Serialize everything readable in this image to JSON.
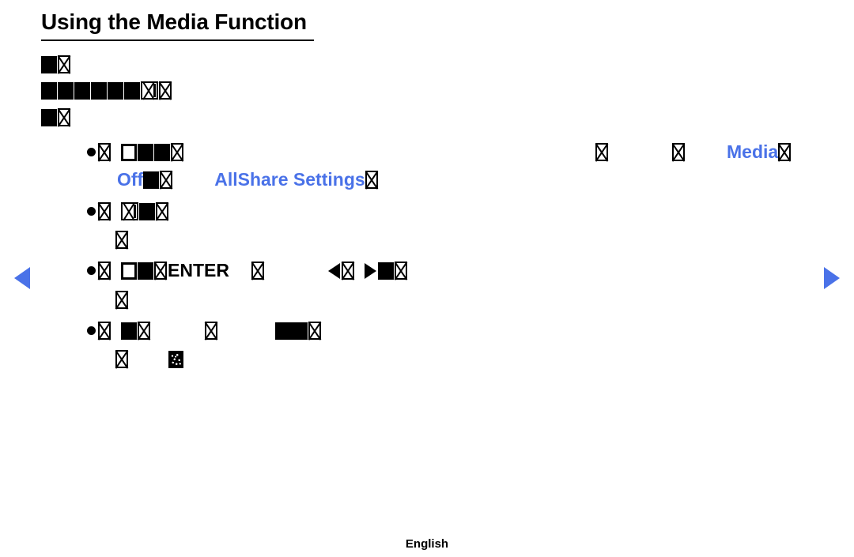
{
  "page": {
    "title": "Using the Media Function",
    "footer_language": "English",
    "accent_color": "#4a72e8",
    "text_color": "#000000",
    "background_color": "#ffffff"
  },
  "nav": {
    "prev_label": "◀",
    "next_label": "▶",
    "prev_name": "previous-page",
    "next_name": "next-page"
  },
  "intro": {
    "line1": "",
    "line2": "",
    "line3": ""
  },
  "bullets": [
    {
      "id": "bullet-allshare",
      "keyword_right": "Media",
      "sub_keyword_1": "Off",
      "sub_keyword_2": "AllShare Settings"
    },
    {
      "id": "bullet-second",
      "keyword_right": "",
      "sub_keyword_1": ""
    },
    {
      "id": "bullet-enter",
      "literal": "ENTER",
      "arrow_left": "◀",
      "arrow_right": "▶"
    },
    {
      "id": "bullet-last",
      "keyword_right": ""
    }
  ],
  "glyphs": {
    "missing_box": "missing-glyph-box",
    "missing_x_box": "missing-glyph-x-box",
    "hollow_box": "missing-glyph-hollow-box",
    "noise_box": "missing-glyph-noise-box",
    "bullet": "●"
  }
}
